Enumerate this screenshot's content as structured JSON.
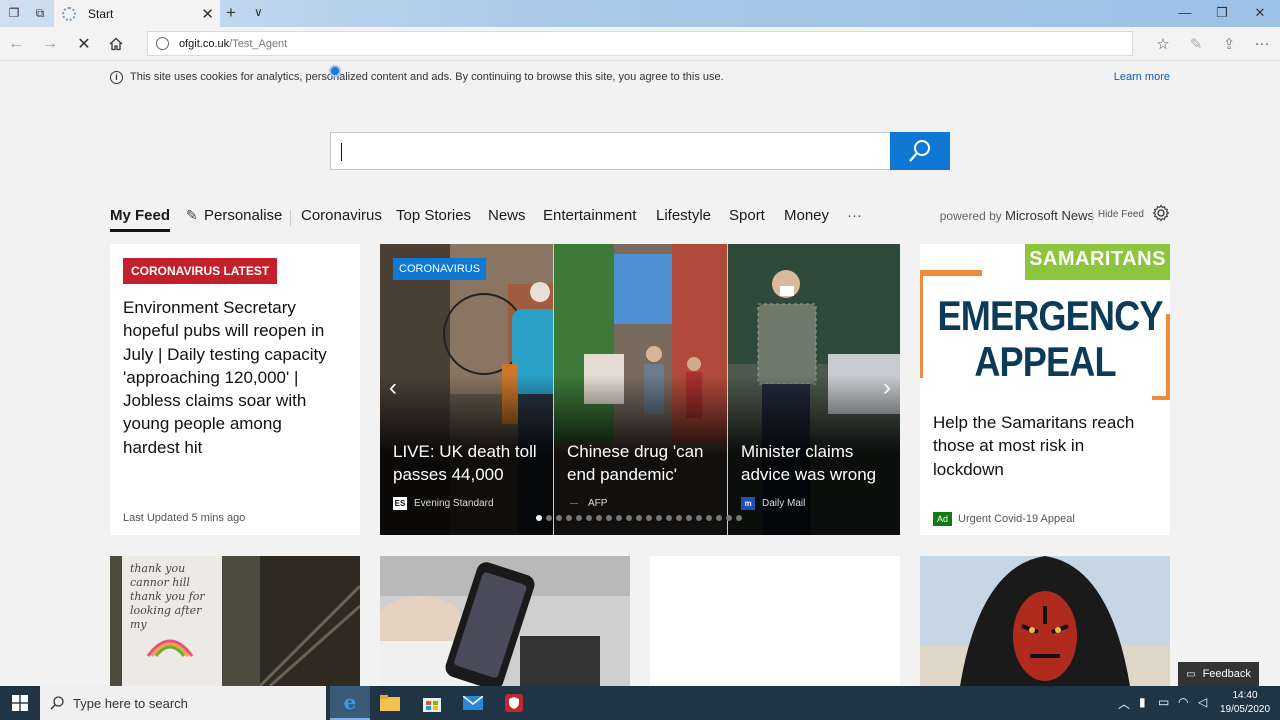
{
  "browser": {
    "tab_title": "Start",
    "url_host": "ofgit.co.uk",
    "url_path": "/Test_Agent"
  },
  "cookie": {
    "message": "This site uses cookies for analytics, personalized content and ads. By continuing to browse this site, you agree to this use.",
    "learn_more": "Learn more"
  },
  "search": {
    "value": "",
    "placeholder": ""
  },
  "feed_nav": {
    "items": [
      "My Feed",
      "Personalise",
      "Coronavirus",
      "Top Stories",
      "News",
      "Entertainment",
      "Lifestyle",
      "Sport",
      "Money",
      "···"
    ],
    "powered_by_prefix": "powered by",
    "powered_by_brand": "Microsoft News",
    "hide_feed": "Hide Feed"
  },
  "cards": {
    "latest": {
      "badge": "CORONAVIRUS LATEST",
      "title": "Environment Secretary hopeful pubs will reopen in July | Daily testing capacity 'approaching 120,000' | Jobless claims soar with young people among hardest hit",
      "footer": "Last Updated 5 mins ago"
    },
    "hero": {
      "badge": "CORONAVIRUS",
      "panels": [
        {
          "title": "LIVE: UK death toll passes 44,000",
          "source": "Evening Standard",
          "logo": "ES"
        },
        {
          "title": "Chinese drug 'can end pandemic'",
          "source": "AFP",
          "logo": "AFP"
        },
        {
          "title": "Minister claims advice was wrong",
          "source": "Daily Mail",
          "logo": "m"
        }
      ],
      "slide_count": 21,
      "active_slide": 1
    },
    "ad": {
      "brand": "SAMARITANS",
      "line1": "EMERGENCY",
      "line2": "APPEAL",
      "title": "Help the Samaritans reach those at most risk in lockdown",
      "ad_label": "Ad",
      "sponsor": "Urgent Covid-19 Appeal"
    },
    "rainbow_note": "thank you cannor hill thank you for looking after my"
  },
  "feedback": "Feedback",
  "taskbar": {
    "search_placeholder": "Type here to search",
    "time": "14:40",
    "date": "19/05/2020"
  },
  "colors": {
    "accent": "#0f78d4",
    "badge_red": "#c4202b",
    "samaritans_green": "#8cc63e",
    "samaritans_orange": "#f08a3c",
    "appeal_navy": "#0c3b57"
  }
}
